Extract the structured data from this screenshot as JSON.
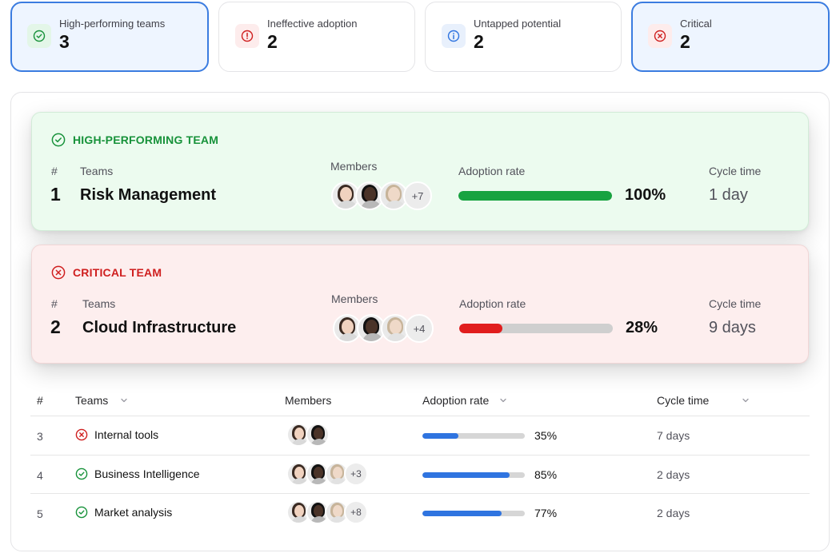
{
  "stats": [
    {
      "label": "High-performing teams",
      "value": "3",
      "icon": "check-circle-icon",
      "color": "#17923a",
      "selected": true
    },
    {
      "label": "Ineffective adoption",
      "value": "2",
      "icon": "alert-circle-icon",
      "color": "#cf1f1f",
      "selected": false
    },
    {
      "label": "Untapped potential",
      "value": "2",
      "icon": "info-circle-icon",
      "color": "#2f74e0",
      "selected": false
    },
    {
      "label": "Critical",
      "value": "2",
      "icon": "x-circle-icon",
      "color": "#cf1f1f",
      "selected": true
    }
  ],
  "headers": {
    "num": "#",
    "teams": "Teams",
    "members": "Members",
    "adoption": "Adoption rate",
    "cycle": "Cycle time"
  },
  "featured": {
    "high": {
      "tag": "HIGH-PERFORMING TEAM",
      "rank": "1",
      "team": "Risk Management",
      "more_members": "+7",
      "adoption_pct": "100%",
      "adoption": 1.0,
      "cycle": "1 day",
      "color": "#17a340"
    },
    "critical": {
      "tag": "CRITICAL TEAM",
      "rank": "2",
      "team": "Cloud Infrastructure",
      "more_members": "+4",
      "adoption_pct": "28%",
      "adoption": 0.28,
      "cycle": "9 days",
      "color": "#e11d1d"
    }
  },
  "rows": [
    {
      "rank": "3",
      "team": "Internal tools",
      "status": "critical",
      "status_icon": "x-circle-icon",
      "more_members": "",
      "adoption_pct": "35%",
      "adoption": 0.35,
      "cycle": "7 days"
    },
    {
      "rank": "4",
      "team": "Business Intelligence",
      "status": "high",
      "status_icon": "check-circle-icon",
      "more_members": "+3",
      "adoption_pct": "85%",
      "adoption": 0.85,
      "cycle": "2 days"
    },
    {
      "rank": "5",
      "team": "Market analysis",
      "status": "high",
      "status_icon": "check-circle-icon",
      "more_members": "+8",
      "adoption_pct": "77%",
      "adoption": 0.77,
      "cycle": "2 days"
    }
  ]
}
